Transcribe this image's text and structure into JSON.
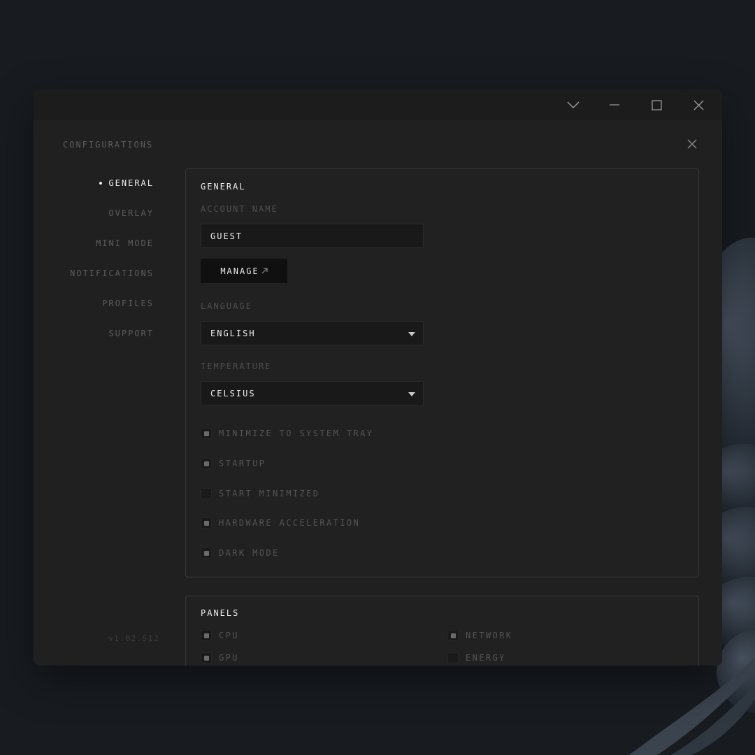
{
  "window": {
    "controls": [
      "chevron-down-icon",
      "minimize-icon",
      "maximize-icon",
      "close-icon"
    ]
  },
  "sidebar": {
    "title": "CONFIGURATIONS",
    "items": [
      {
        "label": "GENERAL",
        "active": true
      },
      {
        "label": "OVERLAY",
        "active": false
      },
      {
        "label": "MINI MODE",
        "active": false
      },
      {
        "label": "NOTIFICATIONS",
        "active": false
      },
      {
        "label": "PROFILES",
        "active": false
      },
      {
        "label": "SUPPORT",
        "active": false
      }
    ],
    "version": "v1.02.512"
  },
  "general": {
    "title": "GENERAL",
    "account_label": "ACCOUNT NAME",
    "account_value": "GUEST",
    "manage_label": "MANAGE",
    "language_label": "LANGUAGE",
    "language_value": "ENGLISH",
    "temperature_label": "TEMPERATURE",
    "temperature_value": "CELSIUS",
    "options": [
      {
        "label": "MINIMIZE TO SYSTEM TRAY",
        "checked": true
      },
      {
        "label": "STARTUP",
        "checked": true
      },
      {
        "label": "START MINIMIZED",
        "checked": false
      },
      {
        "label": "HARDWARE ACCELERATION",
        "checked": true
      },
      {
        "label": "DARK MODE",
        "checked": true
      }
    ]
  },
  "panels": {
    "title": "PANELS",
    "options": [
      {
        "label": "CPU",
        "checked": true
      },
      {
        "label": "NETWORK",
        "checked": true
      },
      {
        "label": "GPU",
        "checked": true
      },
      {
        "label": "ENERGY",
        "checked": false
      }
    ]
  },
  "colors": {
    "background": "#181c21",
    "window": "#202020",
    "accent_text": "#ededed",
    "muted_text": "#5c5c5c"
  }
}
